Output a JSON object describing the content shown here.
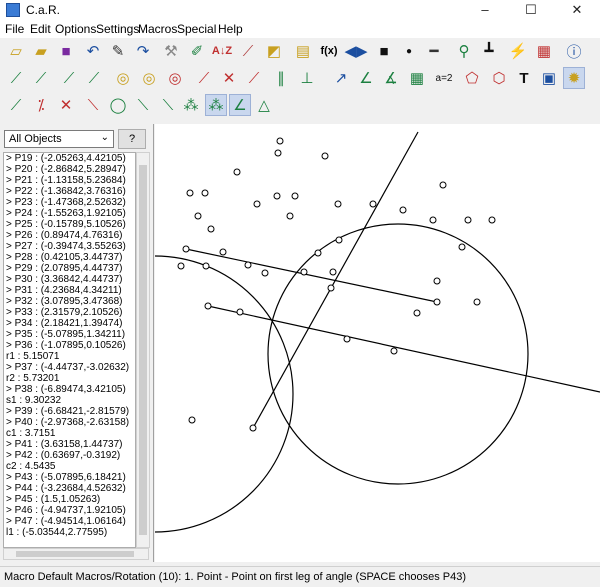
{
  "window": {
    "title": "C.a.R.",
    "controls": [
      "–",
      "☐",
      "✕"
    ]
  },
  "menu": [
    "File",
    "Edit",
    "Options",
    "Settings",
    "Macros",
    "Special",
    "Help"
  ],
  "toolbar": {
    "row1": [
      "new-icon",
      "open-icon",
      "save-icon",
      "undo-icon",
      "delete-icon",
      "redo-icon",
      "hide-icon",
      "color-icon",
      "sort-icon",
      "fix-icon",
      "macro-icon",
      "comment-icon",
      "function-icon",
      "reflect-icon",
      "fill-icon",
      "point-icon",
      "thickness-icon",
      "zoom-icon",
      "axes-icon",
      "wand-icon",
      "palette-icon",
      "info-icon"
    ],
    "row2": [
      "segment-icon",
      "line-icon",
      "ray-icon",
      "line2-icon",
      "circle-icon",
      "circle2-icon",
      "circle3-icon",
      "fixed-segment-icon",
      "intersect-icon",
      "midpoint-icon",
      "parallel-icon",
      "perpendicular-icon",
      "vector-icon",
      "angle-icon",
      "angle2-icon",
      "function-plot-icon",
      "expression-icon",
      "polygon-icon",
      "area-icon",
      "text-icon",
      "picture-icon",
      "macro-run-icon"
    ],
    "row3": [
      "point-on-icon",
      "point2-icon",
      "cross-icon",
      "segment2-icon",
      "circle4-icon",
      "tangent-icon",
      "trace-icon",
      "locus-icon",
      "animate-icon",
      "angle3-icon",
      "triangle-icon"
    ],
    "selected_row2": 21,
    "selected_row3": [
      8,
      9
    ]
  },
  "left_panel": {
    "filter_value": "All Objects",
    "help_label": "?",
    "objects": [
      "> P19 : (-2.05263,4.42105)",
      "> P20 : (-2.86842,5.28947)",
      "> P21 : (-1.13158,5.23684)",
      "> P22 : (-1.36842,3.76316)",
      "> P23 : (-1.47368,2.52632)",
      "> P24 : (-1.55263,1.92105)",
      "> P25 : (-0.15789,5.10526)",
      "> P26 : (0.89474,4.76316)",
      "> P27 : (-0.39474,3.55263)",
      "> P28 : (0.42105,3.44737)",
      "> P29 : (2.07895,4.44737)",
      "> P30 : (3.36842,4.44737)",
      "> P31 : (4.23684,4.34211)",
      "> P32 : (3.07895,3.47368)",
      "> P33 : (2.31579,2.10526)",
      "> P34 : (2.18421,1.39474)",
      "> P35 : (-5.07895,1.34211)",
      "> P36 : (-1.07895,0.10526)",
      "r1 : 5.15071",
      "> P37 : (-4.44737,-3.02632)",
      "r2 : 5.73201",
      "> P38 : (-6.89474,3.42105)",
      "s1 : 9.30232",
      "> P39 : (-6.68421,-2.81579)",
      "> P40 : (-2.97368,-2.63158)",
      "c1 : 3.7151",
      "> P41 : (3.63158,1.44737)",
      "> P42 : (0.63697,-0.3192)",
      "c2 : 4.5435",
      "> P43 : (-5.07895,6.18421)",
      "> P44 : (-3.23684,4.52632)",
      "> P45 : (1.5,1.05263)",
      "> P46 : (-4.94737,1.92105)",
      "> P47 : (-4.94514,1.06164)",
      "l1 : (-5.03544,2.77595)"
    ]
  },
  "status": "Macro Default Macros/Rotation (10): 1. Point - Point on first leg of angle  (SPACE chooses P43)"
}
